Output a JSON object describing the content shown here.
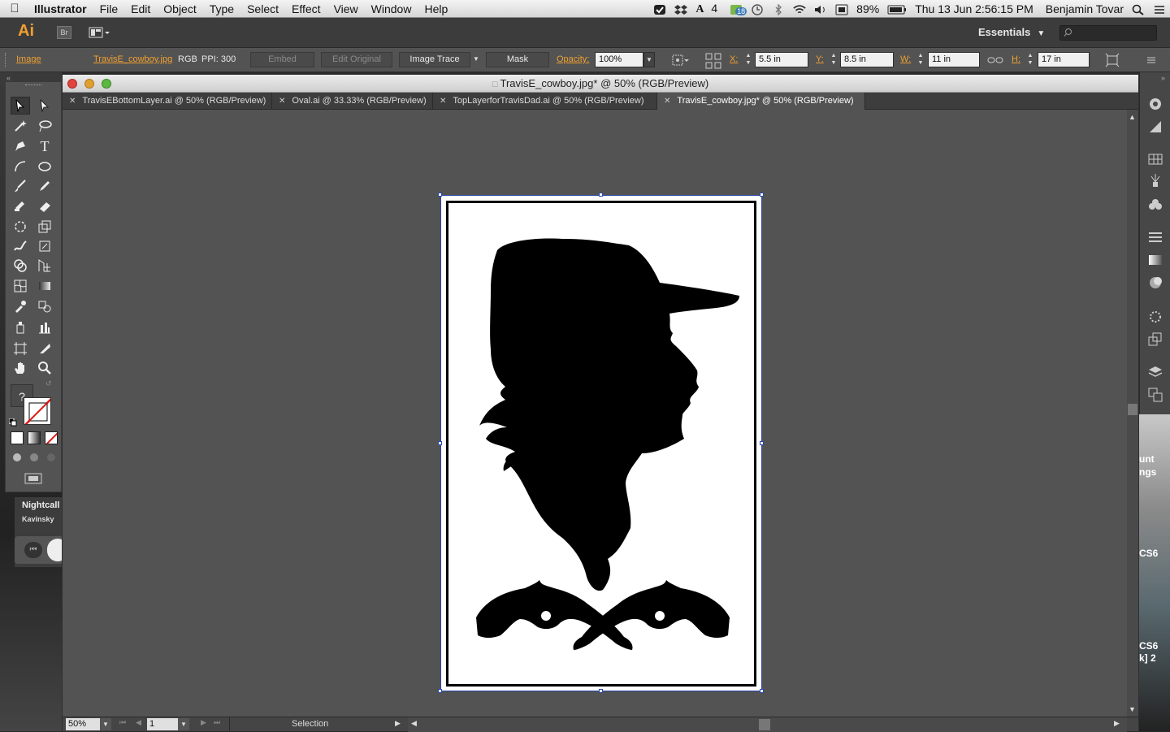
{
  "menubar": {
    "app_name": "Illustrator",
    "items": [
      "File",
      "Edit",
      "Object",
      "Type",
      "Select",
      "Effect",
      "View",
      "Window",
      "Help"
    ],
    "status": {
      "adobe_count": "4",
      "badge_count": "18",
      "battery": "89%",
      "datetime": "Thu 13 Jun  2:56:15 PM",
      "user": "Benjamin Tovar"
    }
  },
  "appbar": {
    "logo": "Ai",
    "bridge_label": "Br",
    "workspace": "Essentials",
    "search_placeholder": ""
  },
  "controlbar": {
    "object_type": "Image",
    "filename": "TravisE_cowboy.jpg",
    "color_mode": "RGB",
    "ppi": "PPI: 300",
    "embed": "Embed",
    "edit_original": "Edit Original",
    "image_trace": "Image Trace",
    "mask": "Mask",
    "opacity_label": "Opacity:",
    "opacity_value": "100%",
    "x_label": "X:",
    "x_value": "5.5 in",
    "y_label": "Y:",
    "y_value": "8.5 in",
    "w_label": "W:",
    "w_value": "11 in",
    "h_label": "H:",
    "h_value": "17 in"
  },
  "document": {
    "window_title": "TravisE_cowboy.jpg* @ 50% (RGB/Preview)",
    "tabs": [
      {
        "label": "TravisEBottomLayer.ai @ 50% (RGB/Preview)"
      },
      {
        "label": "Oval.ai @ 33.33% (RGB/Preview)"
      },
      {
        "label": "TopLayerforTravisDad.ai @ 50% (RGB/Preview)"
      },
      {
        "label": "TravisE_cowboy.jpg* @ 50% (RGB/Preview)"
      }
    ],
    "zoom": "50%",
    "artboard_number": "1",
    "status_tool": "Selection"
  },
  "toolbox": {
    "unknown_glyph": "?"
  },
  "itunes": {
    "track": "Nightcall",
    "artist": "Kavinsky"
  },
  "desktop_right": {
    "label1": "unt",
    "label2": "ngs",
    "label3": "CS6",
    "label4": "CS6",
    "label5": "k] 2"
  }
}
